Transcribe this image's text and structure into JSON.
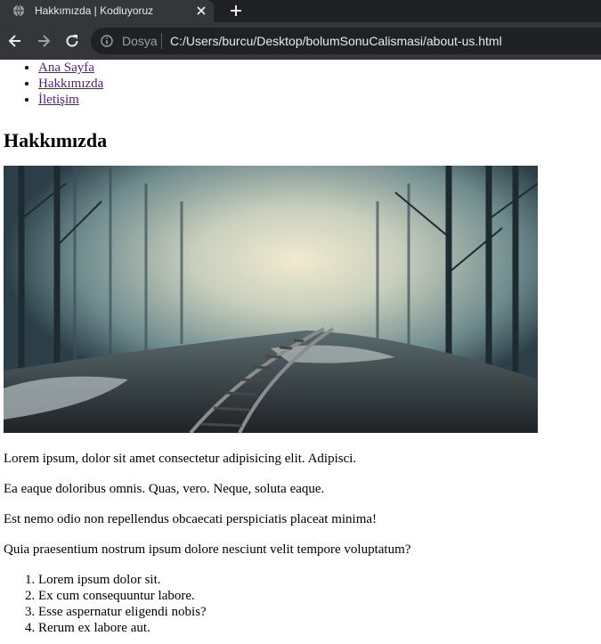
{
  "browser": {
    "tab": {
      "title": "Hakkımızda | Kodluyoruz"
    },
    "address": {
      "security_label": "Dosya",
      "url": "C:/Users/burcu/Desktop/bolumSonuCalismasi/about-us.html"
    },
    "colors": {
      "tabstrip": "#202124",
      "toolbar": "#35363a",
      "omnibox": "#202124"
    }
  },
  "page": {
    "nav": [
      {
        "label": "Ana Sayfa"
      },
      {
        "label": "Hakkımızda"
      },
      {
        "label": "İletişim"
      }
    ],
    "title": "Hakkımızda",
    "paragraphs": [
      "Lorem ipsum, dolor sit amet consectetur adipisicing elit. Adipisci.",
      "Ea eaque doloribus omnis. Quas, vero. Neque, soluta eaque.",
      "Est nemo odio non repellendus obcaecati perspiciatis placeat minima!",
      "Quia praesentium nostrum ipsum dolore nesciunt velit tempore voluptatum?"
    ],
    "ordered_list": [
      "Lorem ipsum dolor sit.",
      "Ex cum consequuntur labore.",
      "Esse aspernatur eligendi nobis?",
      "Rerum ex labore aut."
    ],
    "link_color": "#551a8b"
  }
}
